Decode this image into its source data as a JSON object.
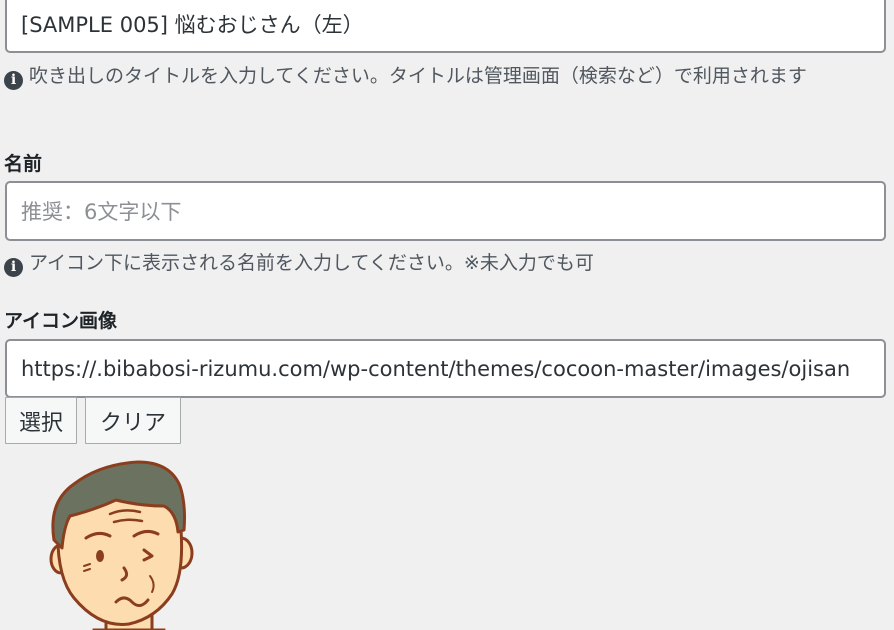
{
  "title_field": {
    "value": "[SAMPLE 005] 悩むおじさん（左）"
  },
  "title_help": "吹き出しのタイトルを入力してください。タイトルは管理画面（検索など）で利用されます",
  "name_field": {
    "label": "名前",
    "placeholder": "推奨：6文字以下",
    "value": ""
  },
  "name_help": "アイコン下に表示される名前を入力してください。※未入力でも可",
  "icon_field": {
    "label": "アイコン画像",
    "value": "https://.bibabosi-rizumu.com/wp-content/themes/cocoon-master/images/ojisan",
    "select_label": "選択",
    "clear_label": "クリア"
  },
  "icons": {
    "help": "info-icon",
    "avatar": "worried-old-man-avatar"
  },
  "colors": {
    "background": "#f0f0f1",
    "input_border": "#8c8f94",
    "skin": "#fddcb0",
    "hair": "#6b7360",
    "outline": "#8a3e1e"
  }
}
